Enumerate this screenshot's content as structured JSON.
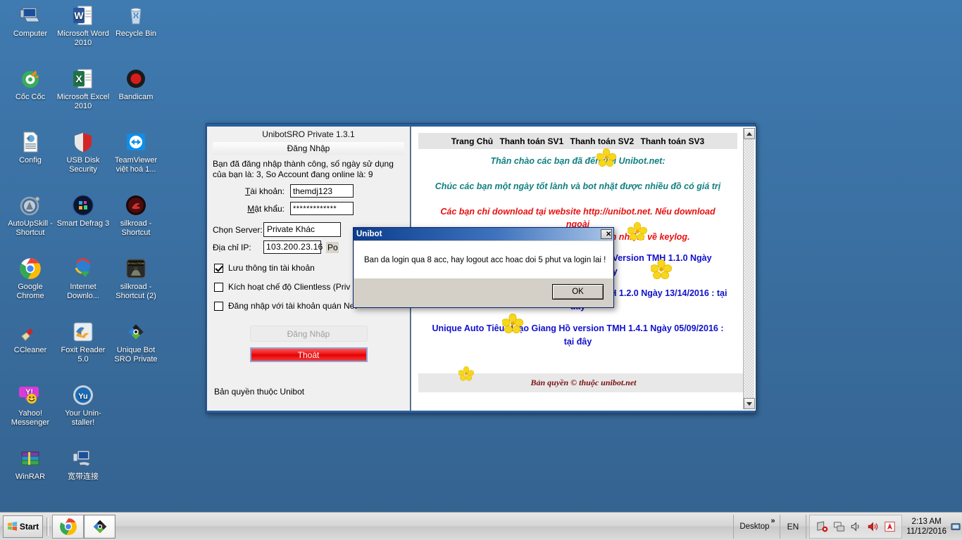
{
  "desktop": {
    "icons": [
      {
        "label": "Computer",
        "icon": "computer-icon",
        "col": 0,
        "row": 0
      },
      {
        "label": "Microsoft Word 2010",
        "icon": "word-icon",
        "col": 1,
        "row": 0
      },
      {
        "label": "Recycle Bin",
        "icon": "recycle-bin-icon",
        "col": 2,
        "row": 0
      },
      {
        "label": "Cốc Cốc",
        "icon": "coccoc-icon",
        "col": 0,
        "row": 1
      },
      {
        "label": "Microsoft Excel 2010",
        "icon": "excel-icon",
        "col": 1,
        "row": 1
      },
      {
        "label": "Bandicam",
        "icon": "bandicam-icon",
        "col": 2,
        "row": 1
      },
      {
        "label": "Config",
        "icon": "config-file-icon",
        "col": 0,
        "row": 2
      },
      {
        "label": "USB Disk Security",
        "icon": "shield-icon",
        "col": 1,
        "row": 2
      },
      {
        "label": "TeamViewer việt hoá 1...",
        "icon": "teamviewer-icon",
        "col": 2,
        "row": 2
      },
      {
        "label": "AutoUpSkill - Shortcut",
        "icon": "autoupskill-icon",
        "col": 0,
        "row": 3
      },
      {
        "label": "Smart Defrag 3",
        "icon": "smart-defrag-icon",
        "col": 1,
        "row": 3
      },
      {
        "label": "silkroad - Shortcut",
        "icon": "silkroad-icon",
        "col": 2,
        "row": 3
      },
      {
        "label": "Google Chrome",
        "icon": "chrome-icon",
        "col": 0,
        "row": 4
      },
      {
        "label": "Internet Downlo...",
        "icon": "idm-icon",
        "col": 1,
        "row": 4
      },
      {
        "label": "silkroad - Shortcut (2)",
        "icon": "silkroad-evolution-icon",
        "col": 2,
        "row": 4
      },
      {
        "label": "CCleaner",
        "icon": "ccleaner-icon",
        "col": 0,
        "row": 5
      },
      {
        "label": "Foxit Reader 5.0",
        "icon": "foxit-reader-icon",
        "col": 1,
        "row": 5
      },
      {
        "label": "Unique Bot SRO Private",
        "icon": "unibot-icon",
        "col": 2,
        "row": 5
      },
      {
        "label": "Yahoo! Messenger",
        "icon": "yahoo-messenger-icon",
        "col": 0,
        "row": 6
      },
      {
        "label": "Your Unin-staller!",
        "icon": "your-uninstaller-icon",
        "col": 1,
        "row": 6
      },
      {
        "label": "WinRAR",
        "icon": "winrar-icon",
        "col": 0,
        "row": 7
      },
      {
        "label": "宽带连接",
        "icon": "broadband-connection-icon",
        "col": 1,
        "row": 7
      }
    ]
  },
  "app": {
    "title": "UnibotSRO Private 1.3.1",
    "tab_label": "Đăng Nhập",
    "status_message": "Bạn đã đăng nhập thành công, số ngày sử dụng của bạn là: 3, So Account đang online là: 9",
    "fields": {
      "account_label": "Tài khoản:",
      "account_value": "themdj123",
      "password_label": "Mật khẩu:",
      "password_value": "*************",
      "server_label": "Chọn Server:",
      "server_value": "Private Khác",
      "ip_label": "Địa chỉ IP:",
      "ip_value": "103.200.23.16",
      "port_label": "Po"
    },
    "checkboxes": [
      {
        "label": "Lưu thông tin tài khoản",
        "checked": true
      },
      {
        "label": "Kích hoạt chế độ Clientless (Priv",
        "checked": false
      },
      {
        "label": "Đăng nhập với tài khoản quán Net",
        "checked": false
      }
    ],
    "login_button": "Đăng Nhập",
    "exit_button": "Thoát",
    "copyright": "Bản quyền thuộc Unibot"
  },
  "web": {
    "nav": [
      "Trang Chủ",
      "Thanh toán SV1",
      "Thanh toán SV2",
      "Thanh toán SV3"
    ],
    "greeting1": "Thân chào các bạn đã đến với Unibot.net:",
    "greeting2": "Chúc các bạn một ngày tốt lành và bot nhặt được nhiều đồ có giá trị",
    "warning_line1": "Các bạn chỉ download tại website http://unibot.net. Nếu download ngoài",
    "warning_line2": "trang đó chúng tôi không chịu trách nhiệm về keylog.",
    "links": [
      "Unique Auto SRO Private 110 VDC 3Job Version TMH 1.1.0 Ngày 09/11/2016 : tại đây",
      "Unique Auto SRO Private 80 TQ Version TMH 1.2.0 Ngày 13/14/2016 : tại đây",
      "Unique Auto Tiêu Ngạo Giang Hồ version TMH 1.4.1 Ngày 05/09/2016 : tại đây"
    ],
    "footer": "Bản quyền © thuộc unibot.net"
  },
  "modal": {
    "title": "Unibot",
    "close_label": "✕",
    "message": "Ban da login qua 8 acc, hay logout acc hoac doi 5 phut va login lai !",
    "ok_label": "OK"
  },
  "taskbar": {
    "start_label": "Start",
    "apps": [
      {
        "name": "chrome-taskbar-button",
        "icon": "chrome-icon"
      },
      {
        "name": "unibot-taskbar-button",
        "icon": "unibot-icon"
      }
    ],
    "desktop_label": "Desktop",
    "chevron": "»",
    "language": "EN",
    "tray_icons": [
      "network-error-icon",
      "network-icon",
      "volume-low-icon",
      "volume-icon",
      "avast-icon"
    ],
    "clock_time": "2:13 AM",
    "clock_date": "11/12/2016"
  },
  "colors": {
    "desktop_bg": "#3a6ea5",
    "titlebar_blue": "#0b3d8c",
    "exit_red": "#e10000",
    "link_blue": "#1010cc",
    "warn_red": "#e81010",
    "greet_teal": "#108080"
  }
}
